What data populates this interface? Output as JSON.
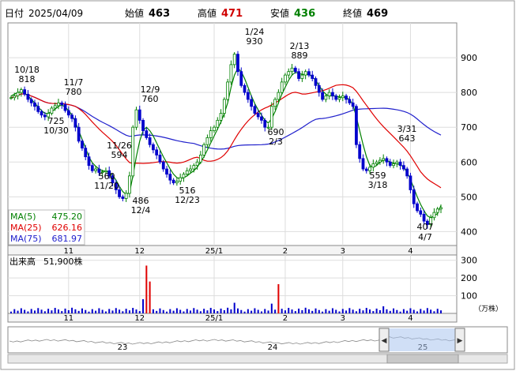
{
  "header": {
    "date_label": "日付",
    "date_value": "2025/04/09",
    "open_label": "始値",
    "open_value": "463",
    "high_label": "高値",
    "high_value": "471",
    "low_label": "安値",
    "low_value": "436",
    "close_label": "終値",
    "close_value": "469"
  },
  "colors": {
    "up": "#008000",
    "down": "#0000cc",
    "ma5": "#008000",
    "ma25": "#e00000",
    "ma75": "#2020cc",
    "volume": "#0000cc",
    "volume_spike": "#e00000",
    "high_color": "#d00000",
    "low_color": "#008000"
  },
  "ma_legend": [
    {
      "label": "MA(5)",
      "value": "475.20",
      "color": "#008000"
    },
    {
      "label": "MA(25)",
      "value": "626.16",
      "color": "#e00000"
    },
    {
      "label": "MA(75)",
      "value": "681.97",
      "color": "#2020cc"
    }
  ],
  "price_axis": {
    "ticks": [
      "900",
      "800",
      "700",
      "600",
      "500",
      "400"
    ],
    "ylim": [
      360,
      1000
    ]
  },
  "month_axis": [
    "11",
    "12",
    "25/1",
    "2",
    "3",
    "4"
  ],
  "volume_panel": {
    "label": "出来高",
    "value": "51,900株",
    "ticks": [
      "300",
      "200",
      "100"
    ],
    "unit": "（万株）",
    "ylim": [
      0,
      330
    ]
  },
  "navigator": {
    "labels": [
      "23",
      "24",
      "25"
    ],
    "left_arrow": "◀",
    "right_arrow": "▶"
  },
  "chart_data": {
    "type": "candlestick",
    "x_range": [
      "2024-10-08",
      "2025-04-09"
    ],
    "annotations": [
      {
        "date": "10/18",
        "value": "818",
        "kind": "high"
      },
      {
        "date": "11/7",
        "value": "780",
        "kind": "high"
      },
      {
        "date": "10/30",
        "value": "725",
        "kind": "low"
      },
      {
        "date": "11/26",
        "value": "594",
        "kind": "high"
      },
      {
        "date": "11/20",
        "value": "560",
        "kind": "low"
      },
      {
        "date": "12/9",
        "value": "760",
        "kind": "high"
      },
      {
        "date": "12/4",
        "value": "486",
        "kind": "low"
      },
      {
        "date": "12/23",
        "value": "516",
        "kind": "low"
      },
      {
        "date": "1/24",
        "value": "930",
        "kind": "high"
      },
      {
        "date": "2/13",
        "value": "889",
        "kind": "high"
      },
      {
        "date": "2/3",
        "value": "690",
        "kind": "low"
      },
      {
        "date": "3/31",
        "value": "643",
        "kind": "high"
      },
      {
        "date": "3/18",
        "value": "559",
        "kind": "low"
      },
      {
        "date": "4/7",
        "value": "407",
        "kind": "low"
      }
    ],
    "close_path": [
      785,
      790,
      800,
      808,
      795,
      780,
      770,
      760,
      745,
      735,
      730,
      740,
      755,
      762,
      770,
      765,
      748,
      735,
      725,
      700,
      660,
      640,
      615,
      590,
      575,
      580,
      570,
      572,
      575,
      560,
      540,
      520,
      500,
      495,
      510,
      560,
      700,
      750,
      720,
      690,
      670,
      650,
      635,
      620,
      600,
      580,
      565,
      548,
      540,
      545,
      555,
      565,
      575,
      580,
      590,
      600,
      620,
      650,
      670,
      690,
      700,
      720,
      740,
      780,
      830,
      880,
      910,
      860,
      820,
      800,
      780,
      760,
      740,
      730,
      720,
      700,
      700,
      760,
      780,
      800,
      830,
      850,
      860,
      870,
      860,
      840,
      850,
      860,
      850,
      840,
      820,
      800,
      780,
      790,
      800,
      790,
      780,
      785,
      790,
      780,
      770,
      760,
      650,
      610,
      580,
      575,
      585,
      595,
      600,
      605,
      610,
      600,
      590,
      595,
      600,
      590,
      580,
      560,
      520,
      480,
      460,
      450,
      430,
      420,
      440,
      455,
      465,
      469
    ],
    "ma5": [
      790,
      795,
      800,
      802,
      798,
      790,
      780,
      770,
      758,
      748,
      740,
      740,
      745,
      752,
      760,
      764,
      758,
      748,
      735,
      715,
      690,
      665,
      640,
      615,
      598,
      588,
      580,
      575,
      573,
      570,
      562,
      548,
      530,
      515,
      507,
      512,
      560,
      615,
      660,
      690,
      700,
      690,
      675,
      655,
      635,
      615,
      598,
      580,
      565,
      555,
      552,
      555,
      560,
      568,
      575,
      585,
      600,
      615,
      635,
      655,
      675,
      695,
      715,
      740,
      770,
      815,
      850,
      870,
      860,
      840,
      815,
      790,
      768,
      750,
      735,
      720,
      712,
      725,
      745,
      770,
      795,
      815,
      835,
      850,
      858,
      855,
      852,
      852,
      852,
      845,
      835,
      820,
      805,
      795,
      790,
      790,
      790,
      787,
      787,
      785,
      780,
      765,
      730,
      690,
      650,
      615,
      590,
      585,
      590,
      600,
      605,
      605,
      600,
      597,
      595,
      592,
      585,
      570,
      550,
      525,
      500,
      478,
      460,
      445,
      440,
      445,
      452,
      475
    ]
  }
}
